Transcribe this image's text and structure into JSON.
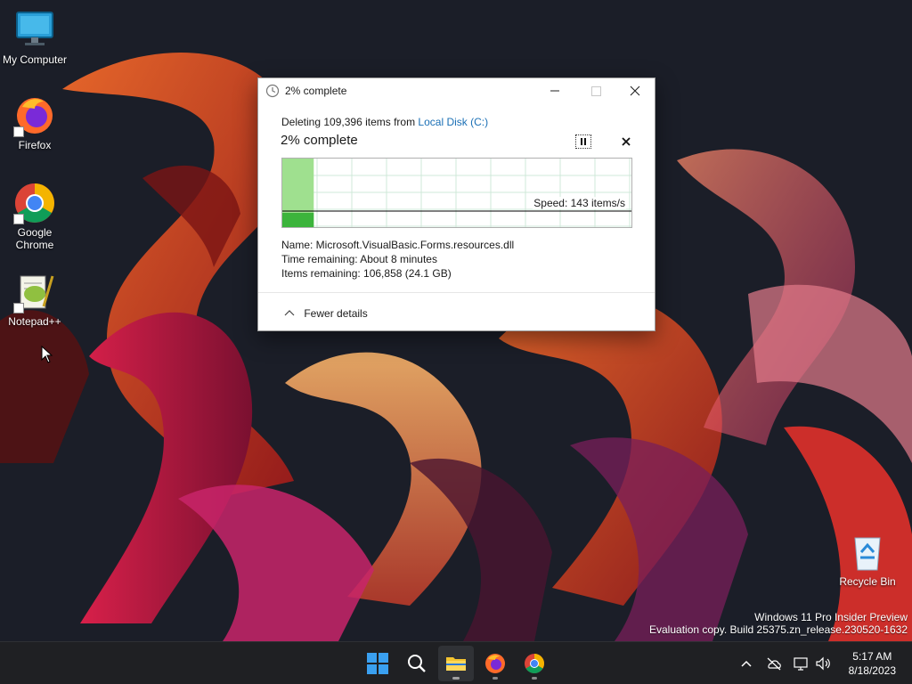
{
  "desktop": {
    "icons": [
      {
        "label": "My Computer"
      },
      {
        "label": "Firefox"
      },
      {
        "label": "Google\nChrome"
      },
      {
        "label": "Notepad++"
      },
      {
        "label": "Recycle Bin"
      }
    ],
    "watermark": {
      "line1": "Windows 11 Pro Insider Preview",
      "line2": "Evaluation copy. Build 25375.zn_release.230520-1632"
    }
  },
  "dialog": {
    "title": "2% complete",
    "summary_prefix": "Deleting 109,396 items from ",
    "summary_link": "Local Disk (C:)",
    "percent_heading": "2% complete",
    "progress_percent": 2,
    "speed": "Speed: 143 items/s",
    "name_line": "Name:  Microsoft.VisualBasic.Forms.resources.dll",
    "time_line": "Time remaining:  About 8 minutes",
    "items_line": "Items remaining:  106,858 (24.1 GB)",
    "fewer_details": "Fewer details",
    "icons": {
      "title": "clock-icon",
      "minimize": "minimize-icon",
      "maximize": "maximize-icon",
      "close": "close-icon",
      "pause": "pause-icon",
      "cancel": "cancel-icon",
      "chevron": "chevron-up-icon"
    }
  },
  "taskbar": {
    "apps": [
      "start",
      "search",
      "file-explorer",
      "firefox",
      "chrome"
    ],
    "active": "file-explorer",
    "clock": {
      "time": "5:17 AM",
      "date": "8/18/2023"
    }
  },
  "colors": {
    "progress_fill": "#3cb43c",
    "graph_grid": "#cfe8d8",
    "link": "#1a6fb5",
    "taskbar": "#1f2023"
  }
}
